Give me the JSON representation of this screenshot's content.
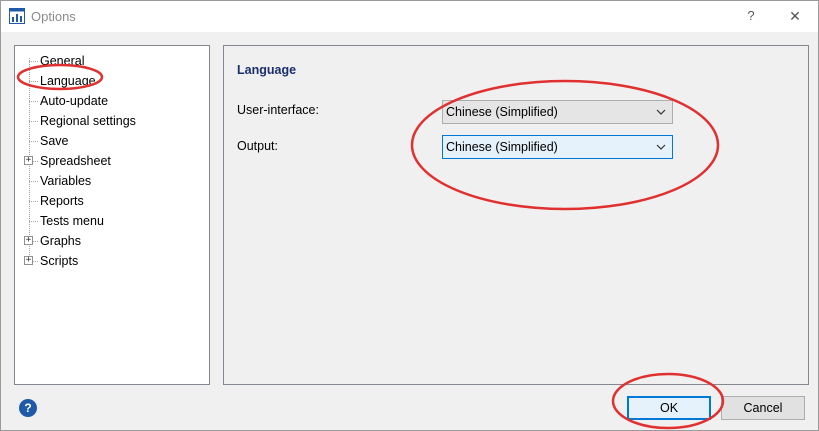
{
  "window": {
    "title": "Options",
    "help_glyph": "?",
    "close_glyph": "✕"
  },
  "tree": {
    "items": [
      {
        "label": "General",
        "expandable": false
      },
      {
        "label": "Language",
        "expandable": false,
        "selected": true
      },
      {
        "label": "Auto-update",
        "expandable": false
      },
      {
        "label": "Regional settings",
        "expandable": false
      },
      {
        "label": "Save",
        "expandable": false
      },
      {
        "label": "Spreadsheet",
        "expandable": true
      },
      {
        "label": "Variables",
        "expandable": false
      },
      {
        "label": "Reports",
        "expandable": false
      },
      {
        "label": "Tests menu",
        "expandable": false
      },
      {
        "label": "Graphs",
        "expandable": true
      },
      {
        "label": "Scripts",
        "expandable": true
      }
    ],
    "expander_glyph": "+"
  },
  "language_page": {
    "title": "Language",
    "ui_label": "User-interface:",
    "ui_value": "Chinese (Simplified)",
    "output_label": "Output:",
    "output_value": "Chinese (Simplified)"
  },
  "footer": {
    "help_glyph": "?",
    "ok_label": "OK",
    "cancel_label": "Cancel"
  },
  "colors": {
    "annotation": "#e03030",
    "title_blue": "#1a2f6e",
    "focus_blue": "#0078d7"
  }
}
